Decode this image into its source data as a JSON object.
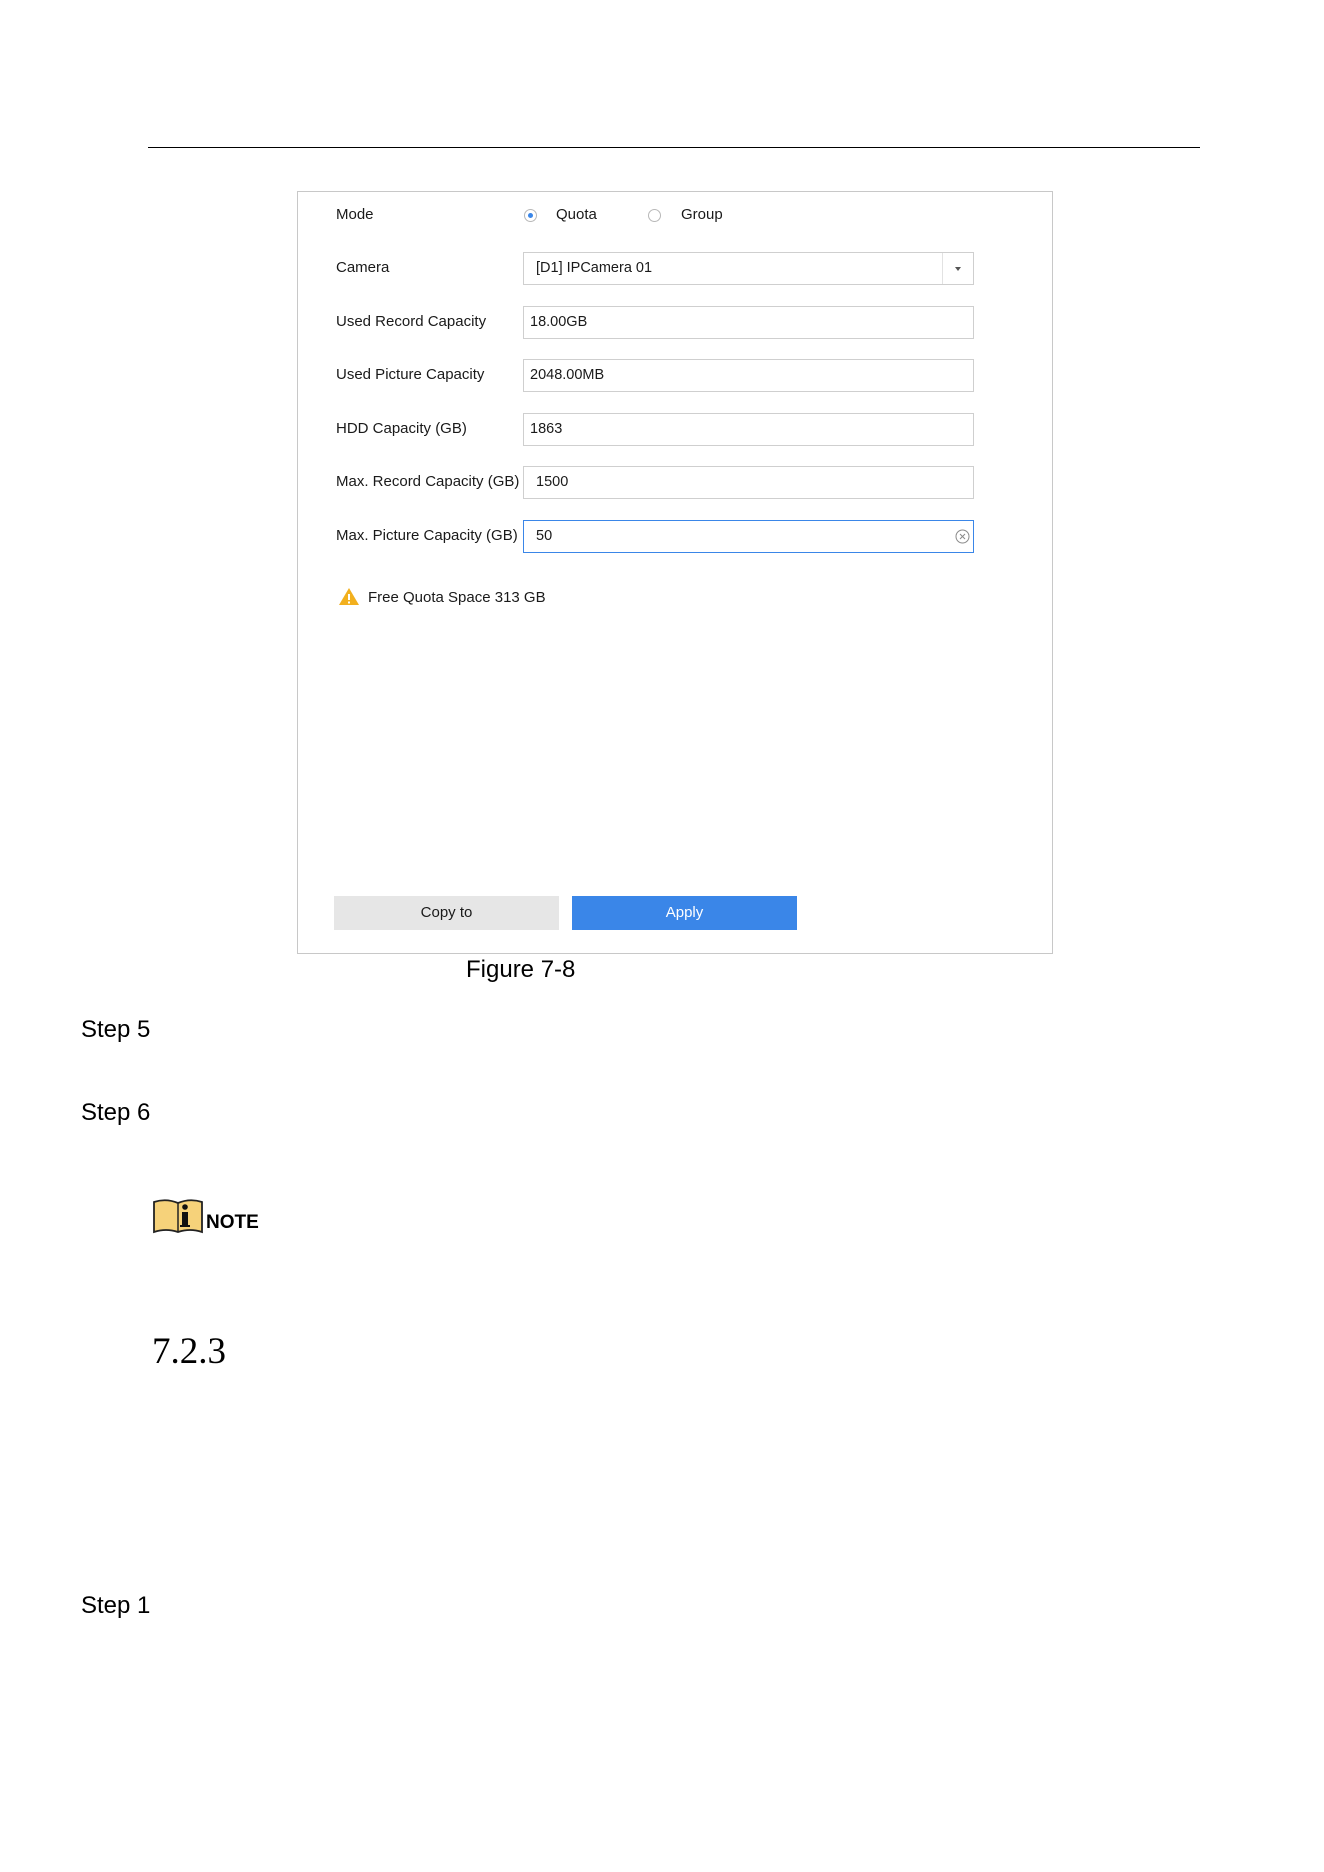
{
  "form": {
    "mode": {
      "label": "Mode",
      "options": [
        "Quota",
        "Group"
      ],
      "selected": "Quota"
    },
    "camera": {
      "label": "Camera",
      "value": "[D1] IPCamera 01"
    },
    "used_record_capacity": {
      "label": "Used Record Capacity",
      "value": "18.00GB"
    },
    "used_picture_capacity": {
      "label": "Used Picture Capacity",
      "value": "2048.00MB"
    },
    "hdd_capacity": {
      "label": "HDD Capacity (GB)",
      "value": "1863"
    },
    "max_record_capacity": {
      "label": "Max. Record Capacity (GB)",
      "value": "1500"
    },
    "max_picture_capacity": {
      "label": "Max. Picture Capacity (GB)",
      "value": "50"
    },
    "warning": "Free Quota Space 313 GB",
    "copy_button": "Copy to",
    "apply_button": "Apply"
  },
  "document": {
    "caption": "Figure 7-8",
    "steps": [
      "Step 5",
      "Step 6",
      "Step 1"
    ],
    "note_label": "NOTE",
    "section_number": "7.2.3"
  },
  "colors": {
    "accent": "#3a86e8",
    "warning": "#f2b01e"
  }
}
